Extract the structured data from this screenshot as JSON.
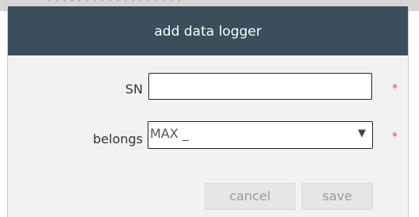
{
  "dialog": {
    "title": "add data logger"
  },
  "form": {
    "sn": {
      "label": "SN",
      "value": "",
      "required_mark": "*"
    },
    "belongs": {
      "label": "belongs",
      "selected": "MAX _",
      "arrow_glyph": "▼",
      "required_mark": "*"
    }
  },
  "buttons": {
    "cancel": "cancel",
    "save": "save"
  },
  "colors": {
    "header_bg": "#3a4e5c",
    "required": "#e0413a",
    "button_bg": "#e6e6e6"
  }
}
